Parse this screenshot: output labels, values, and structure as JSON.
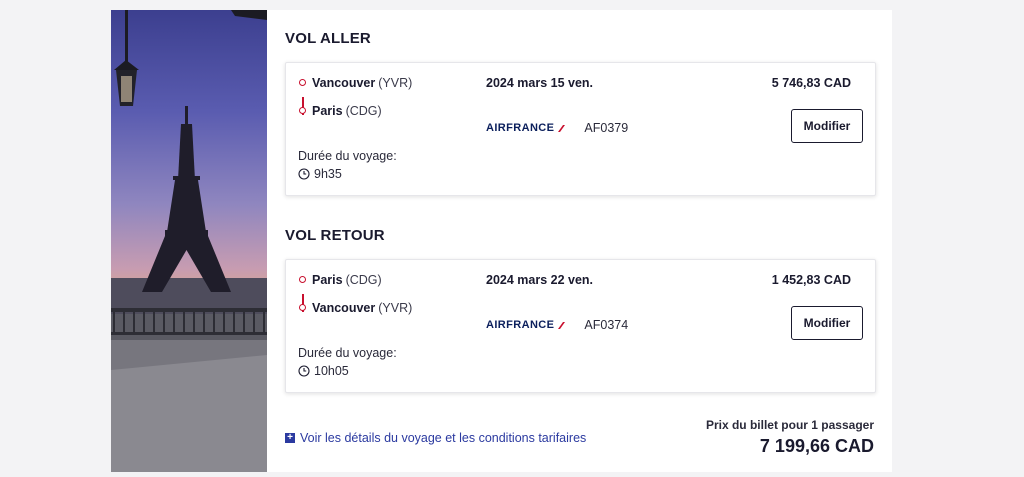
{
  "outbound": {
    "title": "VOL ALLER",
    "origin_city": "Vancouver",
    "origin_code": "(YVR)",
    "dest_city": "Paris",
    "dest_code": "(CDG)",
    "date": "2024 mars 15 ven.",
    "price": "5 746,83 CAD",
    "airline": "AIRFRANCE",
    "flight_number": "AF0379",
    "modify_label": "Modifier",
    "duration_label": "Durée du voyage:",
    "duration": "9h35"
  },
  "return": {
    "title": "VOL RETOUR",
    "origin_city": "Paris",
    "origin_code": "(CDG)",
    "dest_city": "Vancouver",
    "dest_code": "(YVR)",
    "date": "2024 mars 22 ven.",
    "price": "1 452,83 CAD",
    "airline": "AIRFRANCE",
    "flight_number": "AF0374",
    "modify_label": "Modifier",
    "duration_label": "Durée du voyage:",
    "duration": "10h05"
  },
  "footer": {
    "details_link": "Voir les détails du voyage et les conditions tarifaires",
    "total_label": "Prix du billet pour 1 passager",
    "total_value": "7 199,66 CAD"
  },
  "icons": {
    "route_dot": "route-dot-icon",
    "clock": "clock-icon",
    "plus": "plus-square-icon",
    "airline_mark": "air-france-swoosh-icon"
  },
  "colors": {
    "accent_red": "#c8102e",
    "link_blue": "#2b3aa0",
    "text_dark": "#1a1a2e"
  }
}
